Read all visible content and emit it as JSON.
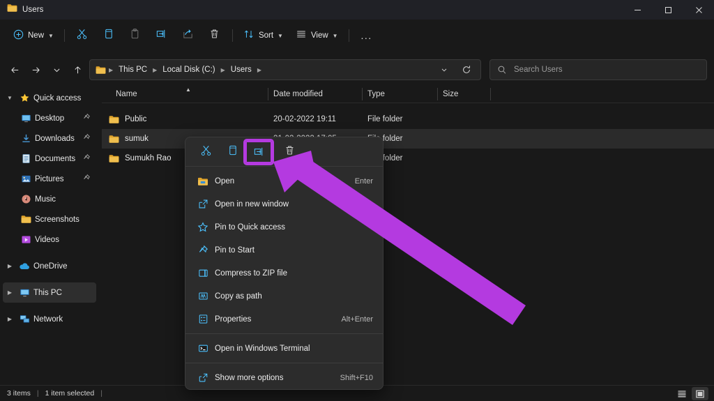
{
  "window": {
    "title": "Users",
    "controls": {
      "minimize": "minimize-button",
      "maximize": "maximize-button",
      "close": "close-button"
    }
  },
  "commandbar": {
    "new_label": "New",
    "buttons": [
      {
        "name": "cut-button",
        "icon": "scissors-icon"
      },
      {
        "name": "copy-button",
        "icon": "copy-icon"
      },
      {
        "name": "paste-button",
        "icon": "clipboard-icon"
      },
      {
        "name": "rename-button",
        "icon": "rename-icon"
      },
      {
        "name": "share-button",
        "icon": "share-icon"
      },
      {
        "name": "delete-button",
        "icon": "trash-icon"
      }
    ],
    "sort_label": "Sort",
    "view_label": "View",
    "more_label": "..."
  },
  "addressbar": {
    "back": "back-arrow-icon",
    "forward": "forward-arrow-icon",
    "recent": "chevron-down-icon",
    "up": "up-arrow-icon",
    "breadcrumbs": [
      "This PC",
      "Local Disk (C:)",
      "Users"
    ],
    "refresh": "refresh-icon"
  },
  "search": {
    "placeholder": "Search Users",
    "value": ""
  },
  "sidebar": {
    "items": [
      {
        "label": "Quick access",
        "icon": "star-icon",
        "expander": "chevron-down",
        "indent": false,
        "pinned": false,
        "selected": false
      },
      {
        "label": "Desktop",
        "icon": "desktop-icon",
        "expander": "",
        "indent": true,
        "pinned": true,
        "selected": false
      },
      {
        "label": "Downloads",
        "icon": "download-icon",
        "expander": "",
        "indent": true,
        "pinned": true,
        "selected": false
      },
      {
        "label": "Documents",
        "icon": "document-icon",
        "expander": "",
        "indent": true,
        "pinned": true,
        "selected": false
      },
      {
        "label": "Pictures",
        "icon": "picture-icon",
        "expander": "",
        "indent": true,
        "pinned": true,
        "selected": false
      },
      {
        "label": "Music",
        "icon": "music-icon",
        "expander": "",
        "indent": true,
        "pinned": false,
        "selected": false
      },
      {
        "label": "Screenshots",
        "icon": "folder-icon",
        "expander": "",
        "indent": true,
        "pinned": false,
        "selected": false
      },
      {
        "label": "Videos",
        "icon": "video-icon",
        "expander": "",
        "indent": true,
        "pinned": false,
        "selected": false
      },
      {
        "label": "OneDrive",
        "icon": "cloud-icon",
        "expander": "chevron-right",
        "indent": false,
        "pinned": false,
        "selected": false
      },
      {
        "label": "This PC",
        "icon": "pc-icon",
        "expander": "chevron-right",
        "indent": false,
        "pinned": false,
        "selected": true
      },
      {
        "label": "Network",
        "icon": "network-icon",
        "expander": "chevron-right",
        "indent": false,
        "pinned": false,
        "selected": false
      }
    ]
  },
  "filelist": {
    "columns": [
      "Name",
      "Date modified",
      "Type",
      "Size"
    ],
    "sort_column": "Name",
    "sort_direction": "ascending",
    "rows": [
      {
        "name": "Public",
        "date": "20-02-2022 19:11",
        "type": "File folder",
        "size": "",
        "selected": false
      },
      {
        "name": "sumuk",
        "date": "21-02-2022 17:05",
        "type": "File folder",
        "size": "",
        "selected": true
      },
      {
        "name": "Sumukh Rao",
        "date": "",
        "type": "File folder",
        "size": "",
        "selected": false
      }
    ]
  },
  "contextmenu": {
    "toolbar": [
      {
        "name": "cut-button",
        "icon": "scissors-icon",
        "highlighted": false
      },
      {
        "name": "copy-button",
        "icon": "copy-icon",
        "highlighted": false
      },
      {
        "name": "rename-button",
        "icon": "rename-icon",
        "highlighted": true
      },
      {
        "name": "delete-button",
        "icon": "trash-icon",
        "highlighted": false
      }
    ],
    "items": [
      {
        "label": "Open",
        "accel": "Enter",
        "icon": "folder-open-icon",
        "separator_after": false
      },
      {
        "label": "Open in new window",
        "accel": "",
        "icon": "new-window-icon",
        "separator_after": false
      },
      {
        "label": "Pin to Quick access",
        "accel": "",
        "icon": "star-outline-icon",
        "separator_after": false
      },
      {
        "label": "Pin to Start",
        "accel": "",
        "icon": "pin-icon",
        "separator_after": false
      },
      {
        "label": "Compress to ZIP file",
        "accel": "",
        "icon": "zip-icon",
        "separator_after": false
      },
      {
        "label": "Copy as path",
        "accel": "",
        "icon": "copy-path-icon",
        "separator_after": false
      },
      {
        "label": "Properties",
        "accel": "Alt+Enter",
        "icon": "properties-icon",
        "separator_after": true
      },
      {
        "label": "Open in Windows Terminal",
        "accel": "",
        "icon": "terminal-icon",
        "separator_after": true
      },
      {
        "label": "Show more options",
        "accel": "Shift+F10",
        "icon": "more-options-icon",
        "separator_after": false
      }
    ]
  },
  "annotation": {
    "arrow_color": "#b43ae0",
    "highlight_color": "#b43ae0",
    "points_to": "rename-button"
  },
  "statusbar": {
    "item_count": "3 items",
    "selection": "1 item selected",
    "views": [
      {
        "name": "details-view-button",
        "active": false
      },
      {
        "name": "large-icons-view-button",
        "active": true
      }
    ]
  },
  "colors": {
    "window_bg": "#191919",
    "titlebar_bg": "#202126",
    "menu_bg": "#2c2c2c",
    "accent_blue": "#4cc2ff",
    "folder_yellow": "#e8b339",
    "selection_bg": "#2b2b2b"
  }
}
